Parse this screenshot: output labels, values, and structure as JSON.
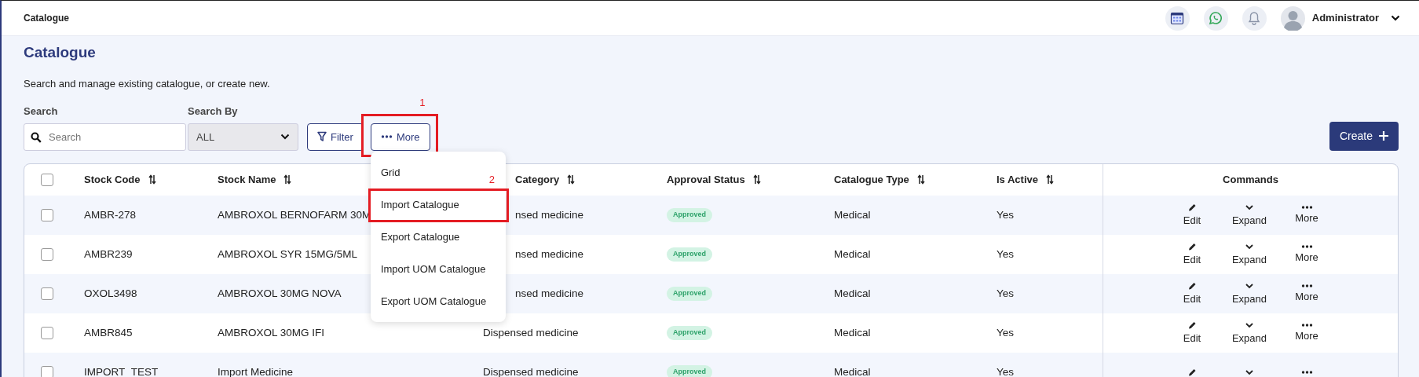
{
  "topbar": {
    "title": "Catalogue",
    "user": "Administrator"
  },
  "page": {
    "title": "Catalogue",
    "subtitle": "Search and manage existing catalogue, or create new."
  },
  "search": {
    "label": "Search",
    "placeholder": "Search"
  },
  "search_by": {
    "label": "Search By",
    "value": "ALL"
  },
  "buttons": {
    "filter": "Filter",
    "more": "More",
    "create": "Create"
  },
  "more_menu": {
    "items": [
      {
        "label": "Grid",
        "annotated": false
      },
      {
        "label": "Import Catalogue",
        "annotated": true
      },
      {
        "label": "Export Catalogue",
        "annotated": false
      },
      {
        "label": "Import UOM Catalogue",
        "annotated": false
      },
      {
        "label": "Export UOM Catalogue",
        "annotated": false
      }
    ]
  },
  "annotations": [
    {
      "label": "1"
    },
    {
      "label": "2"
    }
  ],
  "table": {
    "select_all": {
      "checked": false
    },
    "columns": [
      {
        "label": "Stock Code",
        "sortable": true,
        "partly_hidden": false
      },
      {
        "label": "Stock Name",
        "sortable": true,
        "partly_hidden": false
      },
      {
        "label": "Category",
        "sortable": true,
        "partly_hidden": true
      },
      {
        "label": "Approval Status",
        "sortable": true,
        "partly_hidden": false
      },
      {
        "label": "Catalogue Type",
        "sortable": true,
        "partly_hidden": false
      },
      {
        "label": "Is Active",
        "sortable": true,
        "partly_hidden": false
      },
      {
        "label": "Commands",
        "sortable": false,
        "partly_hidden": false
      }
    ],
    "rows": [
      {
        "checked": false,
        "code": "AMBR-278",
        "name": "AMBROXOL BERNOFARM 30M",
        "category": "nsed medicine",
        "category_partly_hidden": true,
        "status": "Approved",
        "type": "Medical",
        "active": "Yes",
        "commands": [
          {
            "kind": "edit",
            "label": "Edit"
          },
          {
            "kind": "expand",
            "label": "Expand"
          },
          {
            "kind": "more",
            "label": "More"
          }
        ]
      },
      {
        "checked": false,
        "code": "AMBR239",
        "name": "AMBROXOL SYR 15MG/5ML",
        "category": "nsed medicine",
        "category_partly_hidden": true,
        "status": "Approved",
        "type": "Medical",
        "active": "Yes",
        "commands": [
          {
            "kind": "edit",
            "label": "Edit"
          },
          {
            "kind": "expand",
            "label": "Expand"
          },
          {
            "kind": "more",
            "label": "More"
          }
        ]
      },
      {
        "checked": false,
        "code": "OXOL3498",
        "name": "AMBROXOL 30MG NOVA",
        "category": "nsed medicine",
        "category_partly_hidden": true,
        "status": "Approved",
        "type": "Medical",
        "active": "Yes",
        "commands": [
          {
            "kind": "edit",
            "label": "Edit"
          },
          {
            "kind": "expand",
            "label": "Expand"
          },
          {
            "kind": "more",
            "label": "More"
          }
        ]
      },
      {
        "checked": false,
        "code": "AMBR845",
        "name": "AMBROXOL 30MG IFI",
        "category": "Dispensed medicine",
        "category_partly_hidden": false,
        "status": "Approved",
        "type": "Medical",
        "active": "Yes",
        "commands": [
          {
            "kind": "edit",
            "label": "Edit"
          },
          {
            "kind": "expand",
            "label": "Expand"
          },
          {
            "kind": "more",
            "label": "More"
          }
        ]
      },
      {
        "checked": false,
        "code": "IMPORT_TEST",
        "name": "Import Medicine",
        "category": "Dispensed medicine",
        "category_partly_hidden": false,
        "status": "Approved",
        "type": "Medical",
        "active": "Yes",
        "commands": [
          {
            "kind": "edit"
          },
          {
            "kind": "expand"
          },
          {
            "kind": "more"
          }
        ]
      }
    ]
  }
}
